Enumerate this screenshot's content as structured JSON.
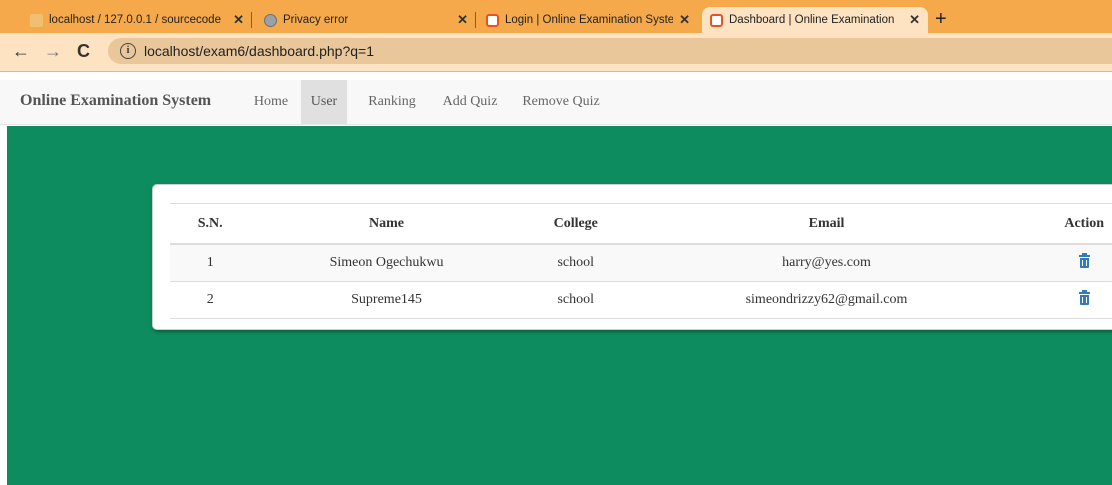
{
  "browser": {
    "tabs": [
      {
        "title": "localhost / 127.0.0.1 / sourcecode",
        "icon": "phpmyadmin-icon"
      },
      {
        "title": "Privacy error",
        "icon": "globe-icon"
      },
      {
        "title": "Login | Online Examination Syste",
        "icon": "site-icon"
      },
      {
        "title": "Dashboard | Online Examination",
        "icon": "site-icon",
        "active": true
      }
    ],
    "new_tab": "+",
    "url": "localhost/exam6/dashboard.php?q=1",
    "tab_color": "#f6a94a"
  },
  "navbar": {
    "brand": "Online Examination System",
    "links": [
      "Home",
      "User",
      "Ranking",
      "Add Quiz",
      "Remove Quiz"
    ],
    "active": "User"
  },
  "table": {
    "headers": [
      "S.N.",
      "Name",
      "College",
      "Email",
      "Action"
    ],
    "rows": [
      [
        "1",
        "Simeon Ogechukwu",
        "school",
        "harry@yes.com"
      ],
      [
        "2",
        "Supreme145",
        "school",
        "simeondrizzy62@gmail.com"
      ]
    ],
    "action_icon": "trash-icon"
  },
  "colors": {
    "background": "#0d8c5f",
    "icon": "#337ab7"
  }
}
